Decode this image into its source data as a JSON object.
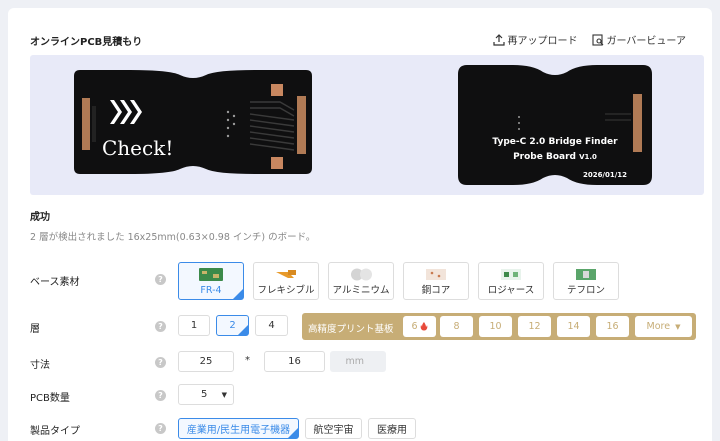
{
  "header": {
    "title": "オンラインPCB見積もり",
    "reupload_label": "再アップロード",
    "gerber_viewer_label": "ガーバービューア"
  },
  "preview": {
    "left_board_text": "Check!",
    "right_board_line1": "Type-C 2.0 Bridge Finder",
    "right_board_line2": "Probe Board",
    "right_board_version": "V1.0",
    "right_board_date": "2026/01/12"
  },
  "result": {
    "title": "成功",
    "description": "2 層が検出されました 16x25mm(0.63×0.98 インチ) のボード。"
  },
  "material": {
    "label": "ベース素材",
    "options": [
      "FR-4",
      "フレキシブル",
      "アルミニウム",
      "銅コア",
      "ロジャース",
      "テフロン"
    ],
    "selected": "FR-4"
  },
  "layers": {
    "label": "層",
    "options": [
      "1",
      "2",
      "4"
    ],
    "selected": "2",
    "hp_label": "高精度プリント基板",
    "hp_options": [
      "6",
      "8",
      "10",
      "12",
      "14",
      "16"
    ],
    "more_label": "More"
  },
  "dimensions": {
    "label": "寸法",
    "width": "25",
    "separator": "*",
    "height": "16",
    "unit": "mm"
  },
  "quantity": {
    "label": "PCB数量",
    "value": "5"
  },
  "product_type": {
    "label": "製品タイプ",
    "options": [
      "産業用/民生用電子機器",
      "航空宇宙",
      "医療用"
    ],
    "selected": "産業用/民生用電子機器"
  },
  "colors": {
    "accent": "#3b8be8",
    "gold": "#c7ad76",
    "board": "#111111"
  }
}
